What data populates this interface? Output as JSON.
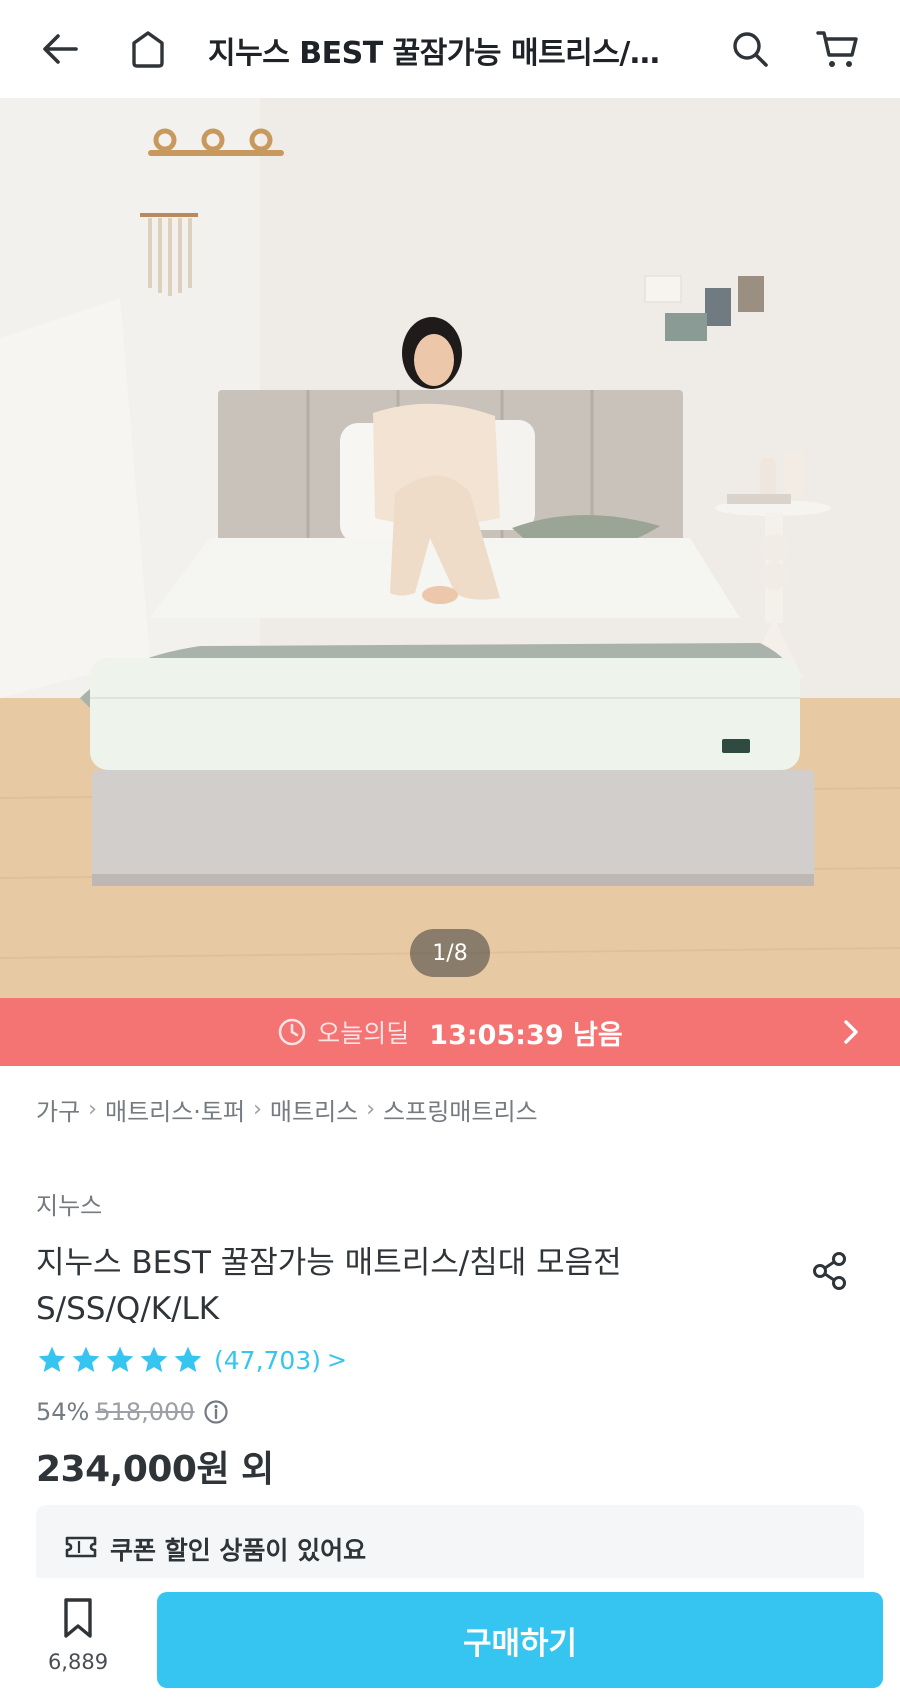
{
  "header": {
    "title": "지누스 BEST 꿀잠가능 매트리스/침대 모음전 S/SS/Q/K/LK",
    "back_icon": "arrow-left-icon",
    "home_icon": "home-icon",
    "search_icon": "search-icon",
    "cart_icon": "cart-icon"
  },
  "gallery": {
    "pager": "1/8"
  },
  "deal": {
    "label": "오늘의딜",
    "time_left": "13:05:39 남음",
    "color": "#f47373"
  },
  "breadcrumb": [
    "가구",
    "매트리스·토퍼",
    "매트리스",
    "스프링매트리스"
  ],
  "product": {
    "brand": "지누스",
    "title": "지누스 BEST 꿀잠가능 매트리스/침대 모음전 S/SS/Q/K/LK",
    "rating": 5,
    "review_count": "(47,703)",
    "review_chevron": ">",
    "discount": "54%",
    "original_price": "518,000",
    "price": "234,000원 외"
  },
  "coupon": {
    "text": "쿠폰 할인 상품이 있어요"
  },
  "bottom": {
    "bookmark_count": "6,889",
    "buy_label": "구매하기",
    "accent": "#35c5f0"
  }
}
